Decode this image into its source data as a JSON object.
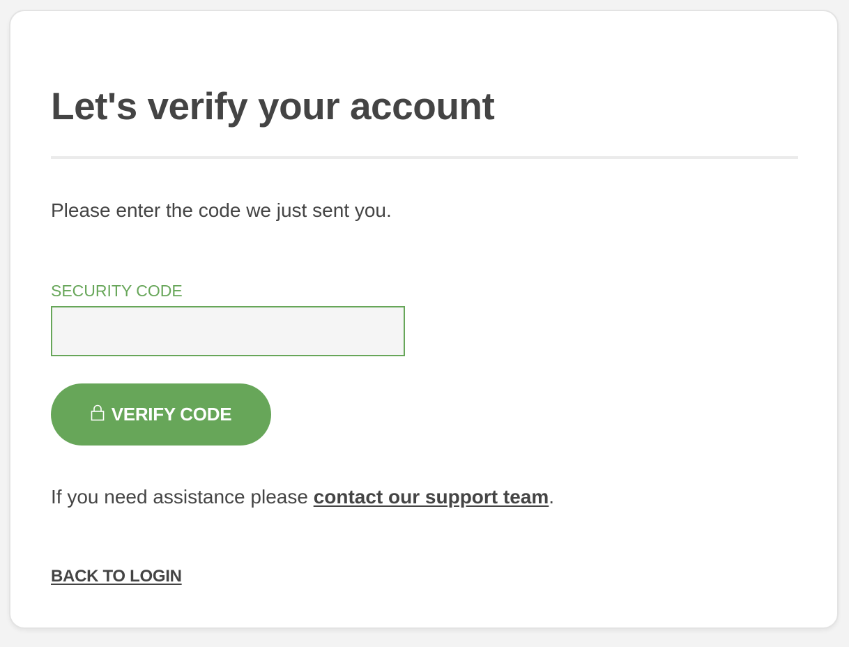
{
  "card": {
    "title": "Let's verify your account",
    "instructions": "Please enter the code we just sent you."
  },
  "form": {
    "security_code_label": "SECURITY CODE",
    "security_code_value": "",
    "security_code_placeholder": "",
    "verify_button_label": "VERIFY CODE",
    "verify_button_icon": "lock-icon"
  },
  "help": {
    "prefix": "If you need assistance please ",
    "link_text": "contact our support team",
    "suffix": "."
  },
  "footer": {
    "back_link": "BACK TO LOGIN"
  },
  "colors": {
    "accent": "#67a659",
    "text": "#444444",
    "input_background": "#f5f5f5",
    "divider": "#ebebeb"
  }
}
